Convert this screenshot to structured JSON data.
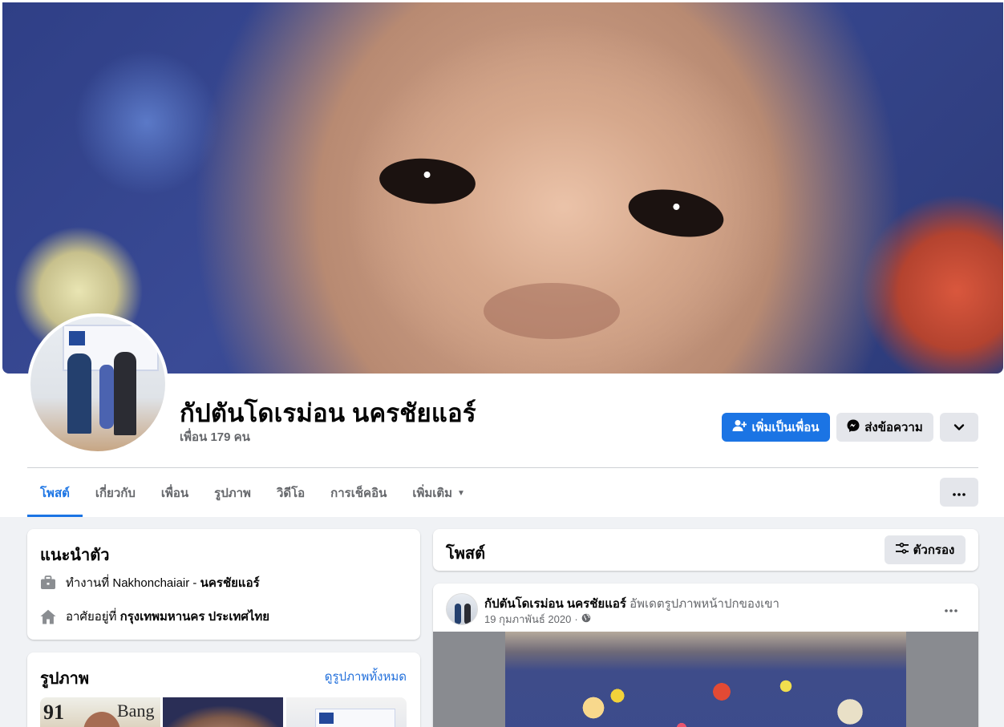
{
  "profile": {
    "name": "กัปตันโดเรม่อน นครชัยแอร์",
    "friend_count": "เพื่อน 179 คน"
  },
  "actions": {
    "add_friend_label": "เพิ่มเป็นเพื่อน",
    "message_label": "ส่งข้อความ"
  },
  "tabs": [
    {
      "label": "โพสต์",
      "active": true
    },
    {
      "label": "เกี่ยวกับ",
      "active": false
    },
    {
      "label": "เพื่อน",
      "active": false
    },
    {
      "label": "รูปภาพ",
      "active": false
    },
    {
      "label": "วิดีโอ",
      "active": false
    },
    {
      "label": "การเช็คอิน",
      "active": false
    },
    {
      "label": "เพิ่มเติม",
      "active": false
    }
  ],
  "intro": {
    "title": "แนะนำตัว",
    "work_prefix": "ทำงานที่ Nakhonchaiair - ",
    "work_place": "นครชัยแอร์",
    "live_prefix": "อาศัยอยู่ที่ ",
    "live_place": "กรุงเทพมหานคร ประเทศไทย"
  },
  "photos": {
    "title": "รูปภาพ",
    "see_all": "ดูรูปภาพทั้งหมด",
    "thumb1_text_a": "91",
    "thumb1_text_b": "Bang"
  },
  "posts": {
    "title": "โพสต์",
    "filter_label": "ตัวกรอง"
  },
  "post": {
    "author": "กัปตันโดเรม่อน นครชัยแอร์",
    "action": " อัพเดตรูปภาพหน้าปกของเขา",
    "date": "19 กุมภาพันธ์ 2020",
    "separator": "·"
  },
  "colors": {
    "accent": "#1b74e4",
    "background": "#f0f2f5",
    "secondary_text": "#65676b"
  },
  "icons": {
    "add_friend": "person-plus-icon",
    "message": "messenger-icon",
    "caret": "chevron-down-icon",
    "more": "more-dots-icon",
    "work": "briefcase-icon",
    "home": "home-icon",
    "filter": "filter-icon",
    "privacy": "globe-icon"
  }
}
